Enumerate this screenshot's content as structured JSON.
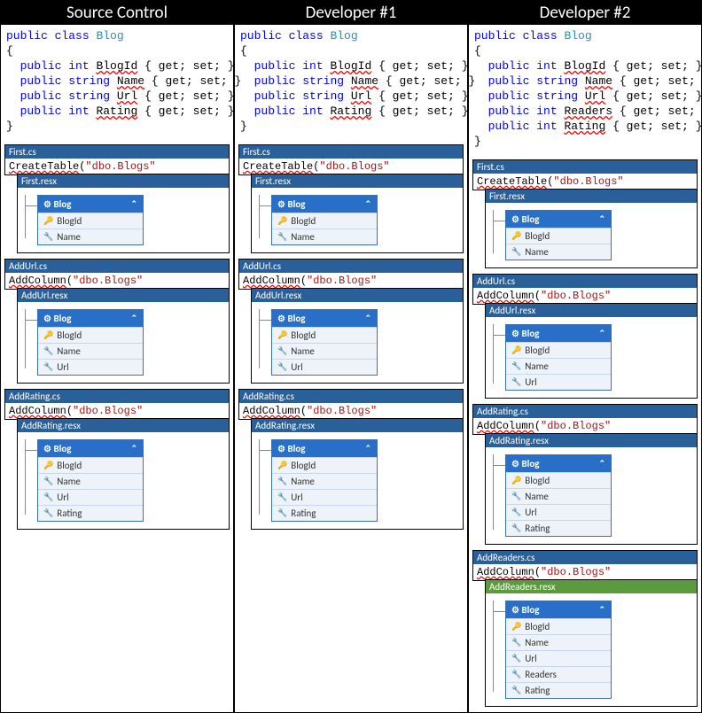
{
  "columns": [
    {
      "title": "Source Control",
      "hasReaders": false,
      "migrations": [
        "First",
        "AddUrl",
        "AddRating"
      ]
    },
    {
      "title": "Developer #1",
      "hasReaders": false,
      "migrations": [
        "First",
        "AddUrl",
        "AddRating"
      ]
    },
    {
      "title": "Developer #2",
      "hasReaders": true,
      "migrations": [
        "First",
        "AddUrl",
        "AddRating",
        "AddReaders"
      ]
    }
  ],
  "code": {
    "classDecl": {
      "public": "public",
      "class": "class",
      "className": "Blog"
    },
    "props": {
      "BlogId": {
        "type": "int",
        "name": "BlogId"
      },
      "Name": {
        "type": "string",
        "name": "Name"
      },
      "Url": {
        "type": "string",
        "name": "Url"
      },
      "Readers": {
        "type": "int",
        "name": "Readers"
      },
      "Rating": {
        "type": "int",
        "name": "Rating"
      }
    },
    "accessor": "{ get; set; }",
    "public": "public"
  },
  "migrations": {
    "First": {
      "cs": "First.cs",
      "resx": "First.resx",
      "method": "CreateTable",
      "arg": "\"dbo.Blogs\"",
      "table": [
        "BlogId",
        "Name"
      ],
      "green": false
    },
    "AddUrl": {
      "cs": "AddUrl.cs",
      "resx": "AddUrl.resx",
      "method": "AddColumn",
      "arg": "\"dbo.Blogs\"",
      "table": [
        "BlogId",
        "Name",
        "Url"
      ],
      "green": false
    },
    "AddRating": {
      "cs": "AddRating.cs",
      "resx": "AddRating.resx",
      "method": "AddColumn",
      "arg": "\"dbo.Blogs\"",
      "table": [
        "BlogId",
        "Name",
        "Url",
        "Rating"
      ],
      "green": false
    },
    "AddReaders": {
      "cs": "AddReaders.cs",
      "resx": "AddReaders.resx",
      "method": "AddColumn",
      "arg": "\"dbo.Blogs\"",
      "table": [
        "BlogId",
        "Name",
        "Url",
        "Readers",
        "Rating"
      ],
      "green": true
    }
  },
  "tableHeader": "Blog",
  "icons": {
    "tableHead": "⚙",
    "pk": "🔑",
    "prop": "🔧",
    "chev": "⌃"
  }
}
